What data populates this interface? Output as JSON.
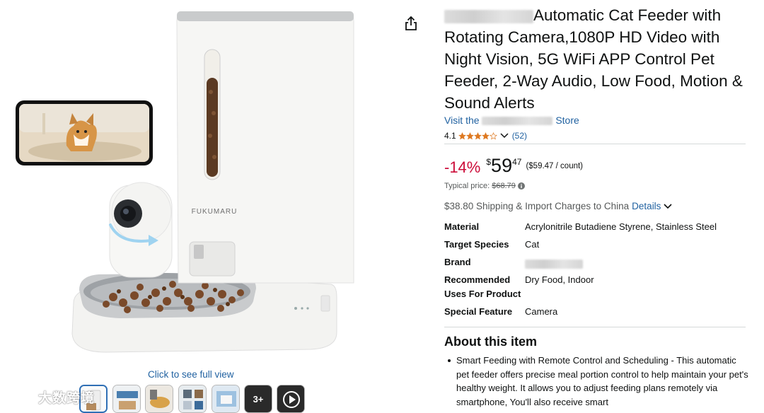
{
  "product": {
    "title_rest": "Automatic Cat Feeder with Rotating Camera,1080P HD Video with Night Vision, 5G WiFi APP Control Pet Feeder, 2-Way Audio, Low Food, Motion & Sound Alerts",
    "store_prefix": "Visit the",
    "store_suffix": "Store",
    "rating_value": "4.1",
    "rating_stars": 4.1,
    "rating_count": "(52)"
  },
  "gallery": {
    "brand_on_device": "FUKUMARU",
    "full_view_label": "Click to see full view",
    "more_thumbs_label": "3+",
    "watermark_text": "大数跨境"
  },
  "pricing": {
    "discount": "-14%",
    "currency": "$",
    "whole": "59",
    "fraction": "47",
    "unit_price": "($59.47 / count)",
    "typical_label": "Typical price:",
    "typical_value": "$68.79",
    "shipping_text": "$38.80 Shipping & Import Charges to China",
    "details_link": "Details"
  },
  "specs": [
    {
      "label": "Material",
      "value": "Acrylonitrile Butadiene Styrene, Stainless Steel"
    },
    {
      "label": "Target Species",
      "value": "Cat"
    },
    {
      "label": "Brand",
      "value": ""
    },
    {
      "label": "Recommended Uses For Product",
      "value": "Dry Food, Indoor"
    },
    {
      "label": "Special Feature",
      "value": "Camera"
    }
  ],
  "about": {
    "title": "About this item",
    "bullets": [
      "Smart Feeding with Remote Control and Scheduling - This automatic pet feeder offers precise meal portion control to help maintain your pet's healthy weight. It allows you to adjust feeding plans remotely via smartphone, You'll also receive smart"
    ]
  },
  "colors": {
    "link": "#2162a1",
    "discount": "#cc0c39",
    "star": "#de7921"
  }
}
